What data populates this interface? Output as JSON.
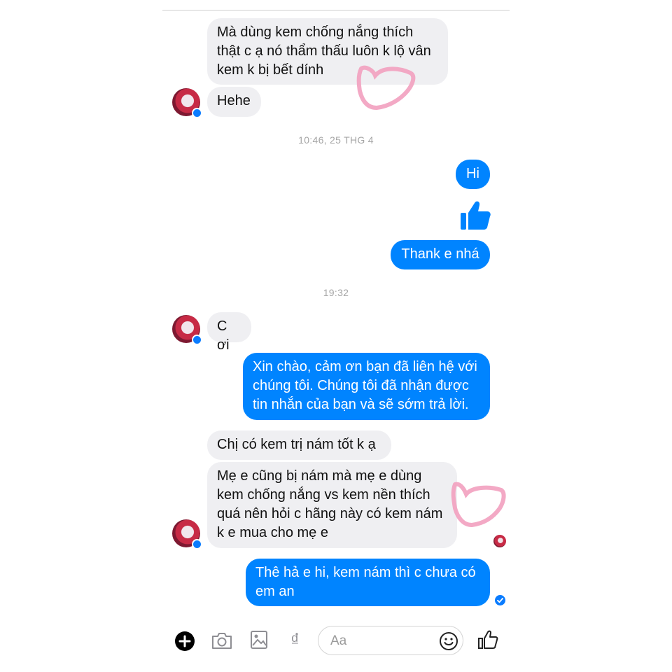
{
  "messages": {
    "m1": "Mà dùng kem chống nắng thích\nthật c ạ nó thẩm thấu luôn k lộ vân\nkem k bị bết dính",
    "m2": "Hehe",
    "ts1": "10:46, 25 THG 4",
    "m3": "Hi",
    "m4": "Thank e nhá",
    "ts2": "19:32",
    "m5": "C ơi",
    "m6": "Xin chào, cảm ơn bạn đã liên hệ với\nchúng tôi. Chúng tôi đã nhận được\ntin nhắn của bạn và sẽ sớm trả lời.",
    "m7": "Chị có kem trị nám tốt k ạ",
    "m8": "Mẹ e cũng bị nám mà mẹ e dùng\nkem chống nắng vs kem nền thích\nquá nên hỏi c hãng này có kem nám\nk e mua cho mẹ e",
    "m9": "Thê hả e hi, kem nám thì c chưa có\nem an"
  },
  "composer": {
    "placeholder": "Aa",
    "currency_symbol": "₫"
  },
  "icons": [
    "plus-icon",
    "camera-icon",
    "image-icon",
    "currency-icon",
    "emoji-icon",
    "like-icon",
    "heart-doodle-icon",
    "seen-check-icon"
  ],
  "colors": {
    "outgoing": "#0084ff",
    "incoming": "#efeff2",
    "heart_doodle": "#f2a0bf"
  }
}
